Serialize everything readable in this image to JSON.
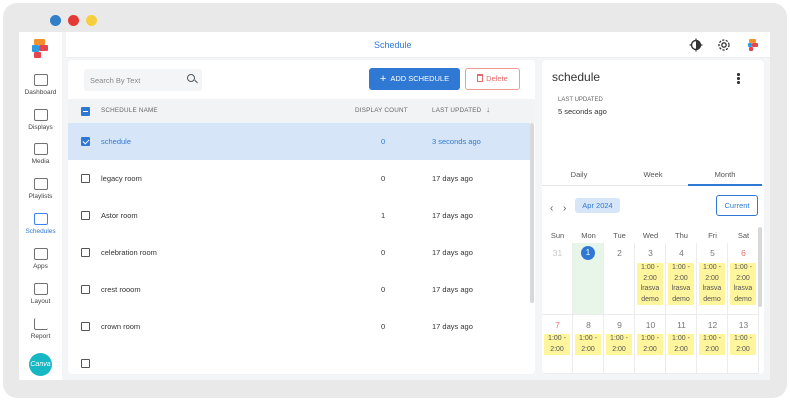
{
  "header": {
    "title": "Schedule"
  },
  "sidebar": {
    "items": [
      {
        "label": "Dashboard",
        "icon": "dashboard-icon"
      },
      {
        "label": "Displays",
        "icon": "display-icon"
      },
      {
        "label": "Media",
        "icon": "media-icon"
      },
      {
        "label": "Playlists",
        "icon": "playlist-icon"
      },
      {
        "label": "Schedules",
        "icon": "calendar-icon",
        "active": true
      },
      {
        "label": "Apps",
        "icon": "apps-icon"
      },
      {
        "label": "Layout",
        "icon": "layout-icon"
      },
      {
        "label": "Report",
        "icon": "chart-icon"
      }
    ],
    "canva_label": "Canva"
  },
  "toolbar": {
    "search_placeholder": "Search By Text",
    "add_label": "ADD SCHEDULE",
    "delete_label": "Delete"
  },
  "table": {
    "columns": [
      "SCHEDULE NAME",
      "DISPLAY COUNT",
      "LAST UPDATED"
    ],
    "rows": [
      {
        "name": "schedule",
        "count": "0",
        "updated": "3 seconds ago",
        "selected": true
      },
      {
        "name": "legacy room",
        "count": "0",
        "updated": "17 days ago"
      },
      {
        "name": "Astor room",
        "count": "1",
        "updated": "17 days ago"
      },
      {
        "name": "celebration room",
        "count": "0",
        "updated": "17 days ago"
      },
      {
        "name": "crest rooom",
        "count": "0",
        "updated": "17 days ago"
      },
      {
        "name": "crown room",
        "count": "0",
        "updated": "17 days ago"
      }
    ]
  },
  "detail": {
    "title": "schedule",
    "last_updated_label": "LAST UPDATED",
    "last_updated_value": "5 seconds ago",
    "tabs": [
      "Daily",
      "Week",
      "Month"
    ],
    "active_tab": "Month",
    "month_label": "Apr 2024",
    "current_label": "Current",
    "weekdays": [
      "Sun",
      "Mon",
      "Tue",
      "Wed",
      "Thu",
      "Fri",
      "Sat"
    ],
    "week1": [
      "31",
      "1",
      "2",
      "3",
      "4",
      "5",
      "6"
    ],
    "week2": [
      "7",
      "8",
      "9",
      "10",
      "11",
      "12",
      "13"
    ],
    "event_week1": [
      "1:00 -",
      "2:00",
      "lrasva",
      "demo"
    ],
    "event_week2": [
      "1:00 -",
      "2:00"
    ]
  },
  "colors": {
    "accent": "#2f78d4",
    "event": "#fff59d",
    "today_bg": "#e8f6ea",
    "danger": "#e46a6a"
  }
}
